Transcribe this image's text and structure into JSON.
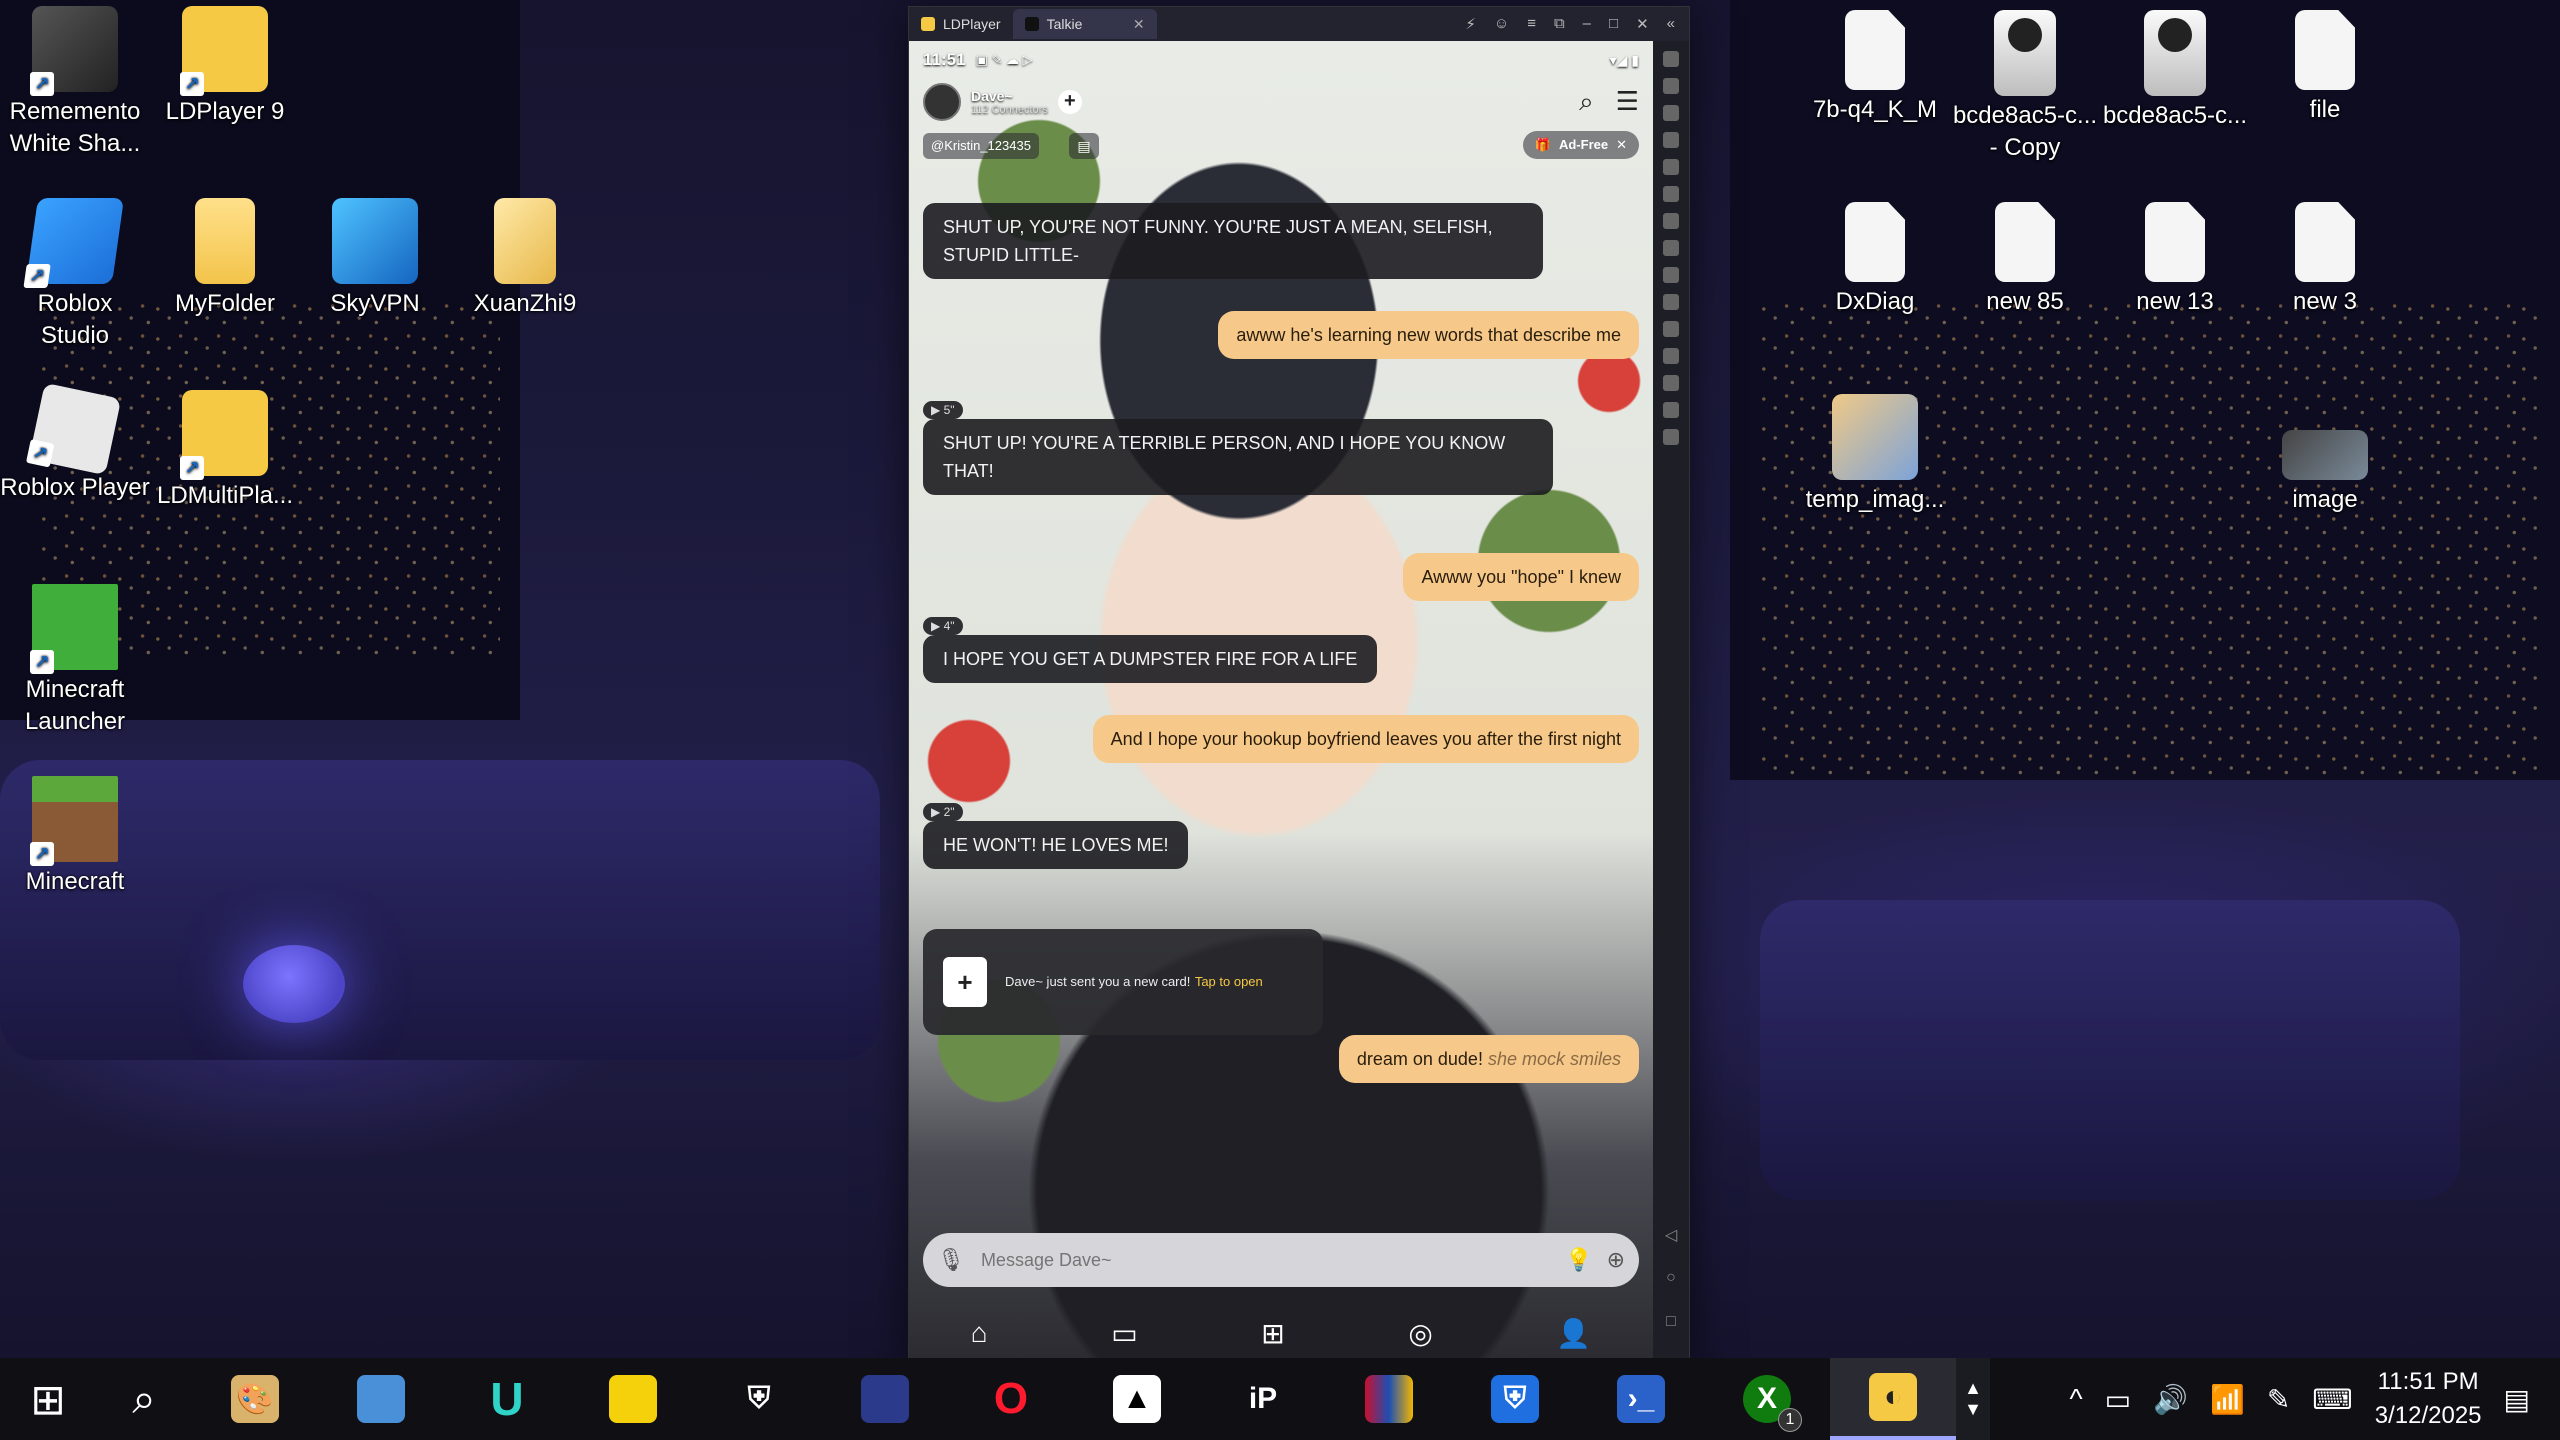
{
  "desktop": {
    "icons": [
      {
        "label": "Rememento\nWhite Sha...",
        "icon": "rememento-icon"
      },
      {
        "label": "LDPlayer 9",
        "icon": "ldplayer-icon"
      },
      {
        "label": "Roblox\nStudio",
        "icon": "roblox-studio-icon"
      },
      {
        "label": "MyFolder",
        "icon": "folder-icon"
      },
      {
        "label": "SkyVPN",
        "icon": "skyvpn-icon"
      },
      {
        "label": "XuanZhi9",
        "icon": "xuanzhi-icon"
      },
      {
        "label": "Roblox Player",
        "icon": "roblox-player-icon"
      },
      {
        "label": "LDMultiPla...",
        "icon": "ldmultiplayer-icon"
      },
      {
        "label": "Minecraft\nLauncher",
        "icon": "minecraft-launcher-icon"
      },
      {
        "label": "Minecraft",
        "icon": "minecraft-icon"
      },
      {
        "label": "7b-q4_K_M",
        "icon": "file-icon"
      },
      {
        "label": "bcde8ac5-c...\n- Copy",
        "icon": "image-file-icon"
      },
      {
        "label": "bcde8ac5-c...",
        "icon": "image-file-icon"
      },
      {
        "label": "file",
        "icon": "file-icon"
      },
      {
        "label": "DxDiag",
        "icon": "file-icon"
      },
      {
        "label": "new 85",
        "icon": "file-icon"
      },
      {
        "label": "new 13",
        "icon": "file-icon"
      },
      {
        "label": "new 3",
        "icon": "file-icon"
      },
      {
        "label": "temp_imag...",
        "icon": "image-file-icon"
      },
      {
        "label": "image",
        "icon": "image-file-icon"
      }
    ]
  },
  "emulator": {
    "tabs": [
      {
        "label": "LDPlayer"
      },
      {
        "label": "Talkie"
      }
    ]
  },
  "phone": {
    "status_time": "11:51",
    "chat_name": "Dave~",
    "connectors": "112 Connectors",
    "user_handle": "@Kristin_123435",
    "adfree_label": "Ad-Free",
    "messages": [
      {
        "from": "bot",
        "text": "SHUT UP, YOU'RE NOT FUNNY. YOU'RE JUST A MEAN, SELFISH, STUPID LITTLE-"
      },
      {
        "from": "user",
        "text": "awww he's learning new words that describe me"
      },
      {
        "from": "bot",
        "duration": "5\"",
        "text": "SHUT UP! YOU'RE A TERRIBLE PERSON, AND I HOPE YOU KNOW THAT!"
      },
      {
        "from": "user",
        "text": "Awww you \"hope\" I knew"
      },
      {
        "from": "bot",
        "duration": "4\"",
        "text": "I HOPE YOU GET A DUMPSTER FIRE FOR A LIFE"
      },
      {
        "from": "user",
        "text": "And I hope your hookup boyfriend leaves you after the first night"
      },
      {
        "from": "bot",
        "duration": "2\"",
        "text": "HE WON'T! HE LOVES ME!"
      },
      {
        "from": "user",
        "text": "dream on dude!",
        "action": "she mock smiles"
      }
    ],
    "card_text": "Dave~ just sent you a new card!",
    "card_tap": "Tap to open",
    "input_placeholder": "Message Dave~"
  },
  "taskbar": {
    "xbox_badge": "1",
    "time": "11:51 PM",
    "date": "3/12/2025"
  }
}
